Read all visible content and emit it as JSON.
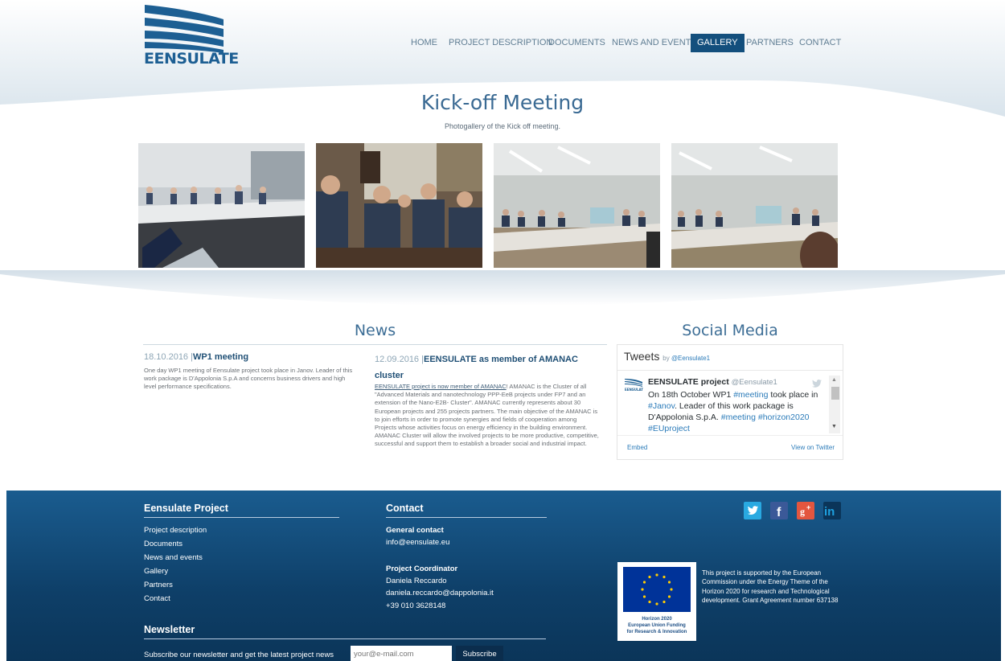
{
  "brand": {
    "name": "EENSULATE"
  },
  "nav": {
    "items": [
      {
        "label": "HOME",
        "active": false
      },
      {
        "label": "PROJECT DESCRIPTION",
        "active": false
      },
      {
        "label": "DOCUMENTS",
        "active": false
      },
      {
        "label": "NEWS AND EVENTS",
        "active": false
      },
      {
        "label": "GALLERY",
        "active": true
      },
      {
        "label": "PARTNERS",
        "active": false
      },
      {
        "label": "CONTACT",
        "active": false
      }
    ]
  },
  "gallery": {
    "title": "Kick-off Meeting",
    "subtitle": "Photogallery of the Kick off meeting."
  },
  "news": {
    "title": "News",
    "items": [
      {
        "date": "18.10.2016",
        "title": "WP1 meeting",
        "body": "One day WP1 meeting of Eensulate project took place in Janov. Leader of this work package is D'Appolonia S.p.A and concerns business drivers and high level performance specifications."
      },
      {
        "date": "12.09.2016",
        "title": "EENSULATE as member of AMANAC cluster",
        "link_text": "EENSULATE project is now member of AMANAC",
        "body": "! AMANAC is the Cluster of all \"Advanced Materials and nanotechnology PPP-EeB projects under FP7 and an extension of the Nano-E2B- Cluster\". AMANAC currently represents about 30 European projects and 255 projects partners. The main objective of the AMANAC is to join efforts in order to promote synergies and fields of cooperation among Projects whose activities focus on energy efficiency in the building environment. AMANAC Cluster will allow the involved projects to be more productive, competitive, successful and support them to establish a broader social and industrial impact."
      }
    ]
  },
  "social": {
    "title": "Social Media",
    "widget": {
      "header": "Tweets",
      "by": "by",
      "handle_link": "@Eensulate1",
      "tweet_name": "EENSULATE project",
      "tweet_handle": "@Eensulate1",
      "tweet_parts": [
        "On 18th October WP1 ",
        "#meeting",
        " took place in ",
        "#Janov",
        ". Leader of this work package is D'Appolonia S.p.A. ",
        "#meeting",
        " ",
        "#horizon2020",
        " ",
        "#EUproject"
      ],
      "embed": "Embed",
      "view": "View on Twitter"
    }
  },
  "footer": {
    "project": {
      "title": "Eensulate Project",
      "links": [
        "Project description",
        "Documents",
        "News and events",
        "Gallery",
        "Partners",
        "Contact"
      ]
    },
    "contact": {
      "title": "Contact",
      "general_label": "General contact",
      "general_email": "info@eensulate.eu",
      "coordinator_label": "Project Coordinator",
      "coordinator_name": "Daniela Reccardo",
      "coordinator_email": "daniela.reccardo@dappolonia.it",
      "coordinator_phone": "+39 010 3628148"
    },
    "newsletter": {
      "title": "Newsletter",
      "label": "Subscribe our newsletter and get the latest project news",
      "placeholder": "your@e-mail.com",
      "button": "Subscribe"
    },
    "eu": {
      "caption_1": "Horizon 2020",
      "caption_2": "European Union Funding",
      "caption_3": "for Research & Innovation",
      "text": "This project is supported by the European Commission under the Energy Theme of the Horizon 2020 for research and Technological development. Grant Agreement number 637138"
    },
    "social_icons": [
      "twitter-icon",
      "facebook-icon",
      "google-plus-icon",
      "linkedin-icon"
    ]
  },
  "colors": {
    "primary": "#134f7d",
    "footer": "#0e3f68",
    "link": "#2b7bb9"
  }
}
